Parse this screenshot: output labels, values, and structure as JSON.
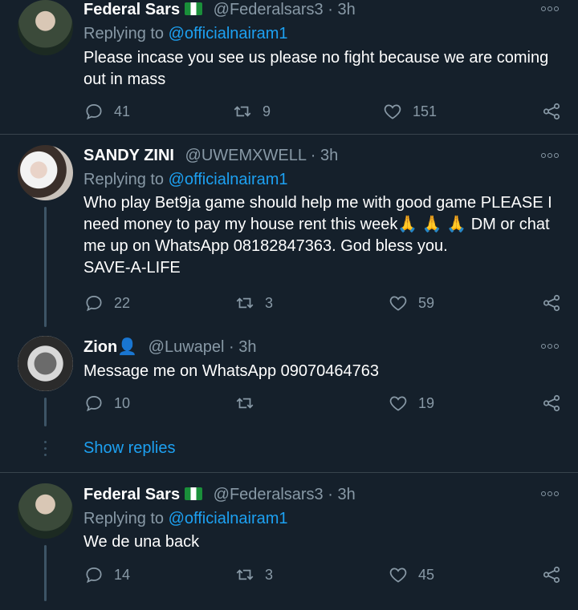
{
  "tweets": [
    {
      "name": "Federal Sars",
      "handle": "@Federalsars3",
      "dot": "·",
      "time": "3h",
      "replying_prefix": "Replying to",
      "replying_to": "@officialnairam1",
      "text": "Please incase you see us please no fight because we are coming out in mass",
      "replies": "41",
      "retweets": "9",
      "likes": "151"
    },
    {
      "name": "SANDY ZINI",
      "handle": "@UWEMXWELL",
      "dot": "·",
      "time": "3h",
      "replying_prefix": "Replying to",
      "replying_to": "@officialnairam1",
      "text": "Who play Bet9ja game should help me with good game PLEASE I need money to pay my house rent this week🙏 🙏 🙏 DM or chat me up on WhatsApp 08182847363. God bless you.\nSAVE-A-LIFE",
      "replies": "22",
      "retweets": "3",
      "likes": "59"
    },
    {
      "name": "Zion👤",
      "handle": "@Luwapel",
      "dot": "·",
      "time": "3h",
      "text": "Message me on WhatsApp 09070464763",
      "replies": "10",
      "retweets": "",
      "likes": "19"
    },
    {
      "name": "Federal Sars",
      "handle": "@Federalsars3",
      "dot": "·",
      "time": "3h",
      "replying_prefix": "Replying to",
      "replying_to": "@officialnairam1",
      "text": "We de una back",
      "replies": "14",
      "retweets": "3",
      "likes": "45"
    }
  ],
  "show_replies": "Show replies",
  "icons": {
    "reply": "reply-icon",
    "retweet": "retweet-icon",
    "like": "heart-icon",
    "share": "share-icon",
    "more": "more-icon",
    "flag": "nigeria-flag-icon"
  },
  "colors": {
    "background": "#15202b",
    "accent": "#1da1f2",
    "muted": "#8899a6",
    "separator": "#38444d"
  }
}
